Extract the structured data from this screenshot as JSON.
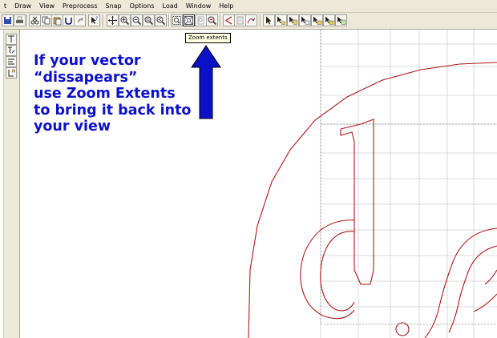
{
  "menu": {
    "items": [
      "t",
      "Draw",
      "View",
      "Preprocess",
      "Snap",
      "Options",
      "Load",
      "Window",
      "Help"
    ]
  },
  "toolbar": {
    "tooltip": "Zoom extents"
  },
  "annotation": {
    "lines": [
      "If your vector",
      "“dissapears”",
      "use Zoom Extents",
      "to bring it back into",
      "your view"
    ]
  },
  "colors": {
    "annotation": "#0d12c9",
    "vector": "#b01818",
    "grid": "#cfcfcf",
    "chrome": "#ece9d8"
  }
}
